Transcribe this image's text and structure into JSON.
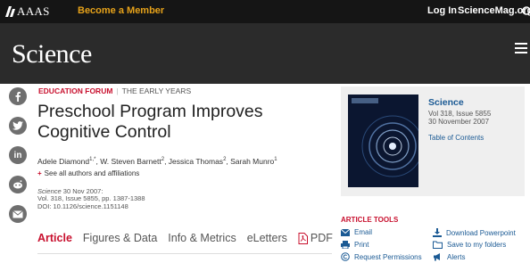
{
  "topbar": {
    "aaas": "AAAS",
    "become_member": "Become a Member",
    "login": "Log In",
    "sciencemag": "ScienceMag.org",
    "accent": "#e6a21a"
  },
  "header": {
    "wordmark": "Science"
  },
  "share_icons": [
    "facebook-icon",
    "twitter-icon",
    "linkedin-icon",
    "reddit-icon",
    "email-icon"
  ],
  "article": {
    "section": "EDUCATION FORUM",
    "subsection": "THE EARLY YEARS",
    "title": "Preschool Program Improves Cognitive Control",
    "authors": [
      {
        "name": "Adele Diamond",
        "sup": "1,*"
      },
      {
        "name": "W. Steven Barnett",
        "sup": "2"
      },
      {
        "name": "Jessica Thomas",
        "sup": "2"
      },
      {
        "name": "Sarah Munro",
        "sup": "1"
      }
    ],
    "see_all": "See all authors and affiliations",
    "journal": "Science",
    "date": "30 Nov 2007:",
    "volume_line": "Vol. 318, Issue 5855, pp. 1387-1388",
    "doi": "DOI: 10.1126/science.1151148"
  },
  "tabs": {
    "article": "Article",
    "figures": "Figures & Data",
    "info": "Info & Metrics",
    "eletters": "eLetters",
    "pdf": "PDF"
  },
  "issue": {
    "title": "Science",
    "volume": "Vol 318, Issue 5855",
    "date": "30 November 2007",
    "toc": "Table of Contents"
  },
  "tools": {
    "heading": "ARTICLE TOOLS",
    "email": "Email",
    "print": "Print",
    "permissions": "Request Permissions",
    "download_ppt": "Download Powerpoint",
    "save": "Save to my folders",
    "alerts": "Alerts"
  },
  "colors": {
    "red": "#c8102e",
    "blue": "#1b5a94",
    "header": "#2b2b2b"
  }
}
